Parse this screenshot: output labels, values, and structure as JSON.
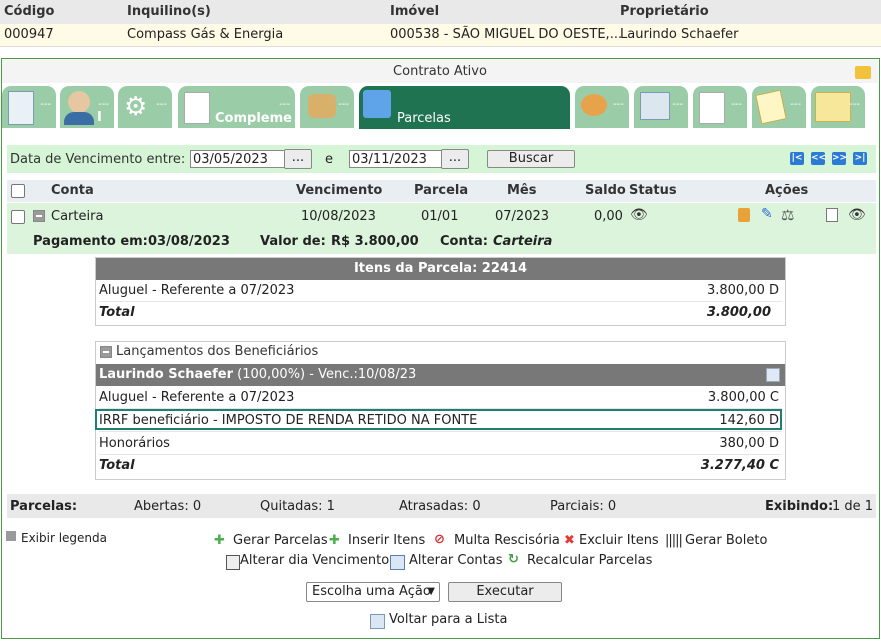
{
  "header": {
    "col_codigo": "Código",
    "col_inquilino": "Inquilino(s)",
    "col_imovel": "Imóvel",
    "col_proprietario": "Proprietário",
    "codigo": "000947",
    "inquilino": "Compass Gás & Energia",
    "imovel": "000538 - SÃO MIGUEL DO OESTE,...",
    "proprietario": "Laurindo Schaefer"
  },
  "contract_title": "Contrato Ativo",
  "tabs": [
    {
      "label": "",
      "dots": "---"
    },
    {
      "label": "I",
      "dots": "---"
    },
    {
      "label": "",
      "dots": "---"
    },
    {
      "label": "Compleme",
      "dots": "---"
    },
    {
      "label": "",
      "dots": "---"
    },
    {
      "label": "Parcelas",
      "dots": "---"
    },
    {
      "label": "",
      "dots": "---"
    },
    {
      "label": "",
      "dots": "---"
    },
    {
      "label": "",
      "dots": "---"
    },
    {
      "label": "",
      "dots": "---"
    },
    {
      "label": "",
      "dots": "---"
    }
  ],
  "filter": {
    "label": "Data de Vencimento entre:",
    "date_from": "03/05/2023",
    "date_to": "03/11/2023",
    "between": "e",
    "ellipsis": "...",
    "search_label": "Buscar"
  },
  "table": {
    "headers": {
      "conta": "Conta",
      "vencimento": "Vencimento",
      "parcela": "Parcela",
      "mes": "Mês",
      "saldo": "Saldo",
      "status": "Status",
      "acoes": "Ações"
    },
    "row": {
      "conta": "Carteira",
      "vencimento": "10/08/2023",
      "parcela": "01/01",
      "mes": "07/2023",
      "saldo": "0,00"
    },
    "detail": {
      "pagamento_label": "Pagamento em:",
      "pagamento": "03/08/2023",
      "valor_label": "Valor de:",
      "valor": "R$ 3.800,00",
      "conta_label": "Conta:",
      "conta": "Carteira"
    }
  },
  "items_panel": {
    "title": "Itens da Parcela: 22414",
    "rows": [
      {
        "desc": "Aluguel - Referente a 07/2023",
        "value": "3.800,00 D"
      }
    ],
    "total_label": "Total",
    "total": "3.800,00"
  },
  "beneficiarios": {
    "title": "Lançamentos dos Beneficiários",
    "owner": "Laurindo Schaefer",
    "owner_pct": "(100,00%) - Venc.:10/08/23",
    "rows": [
      {
        "desc": "Aluguel - Referente a 07/2023",
        "value": "3.800,00 C"
      },
      {
        "desc": "IRRF beneficiário - IMPOSTO DE RENDA RETIDO NA FONTE",
        "value": "142,60 D"
      },
      {
        "desc": "Honorários",
        "value": "380,00 D"
      }
    ],
    "total_label": "Total",
    "total": "3.277,40 C"
  },
  "summary": {
    "parcelas": "Parcelas:",
    "abertas": "Abertas: 0",
    "quitadas": "Quitadas: 1",
    "atrasadas": "Atrasadas: 0",
    "parciais": "Parciais: 0",
    "exibindo_label": "Exibindo:",
    "exibindo": "1 de 1"
  },
  "legend_label": "Exibir legenda",
  "actions": {
    "gerar_parcelas": "Gerar Parcelas",
    "inserir_itens": "Inserir Itens",
    "multa": "Multa Rescisória",
    "excluir_itens": "Excluir Itens",
    "gerar_boleto": "Gerar Boleto",
    "alterar_dia": "Alterar dia Vencimento",
    "alterar_contas": "Alterar Contas",
    "recalcular": "Recalcular Parcelas"
  },
  "action_select": "Escolha uma Ação",
  "execute_label": "Executar",
  "back_label": "Voltar para a Lista",
  "colors": {
    "accent_green": "#1f7350",
    "tab_green": "#9bcca8",
    "highlight": "#1e7f73"
  }
}
